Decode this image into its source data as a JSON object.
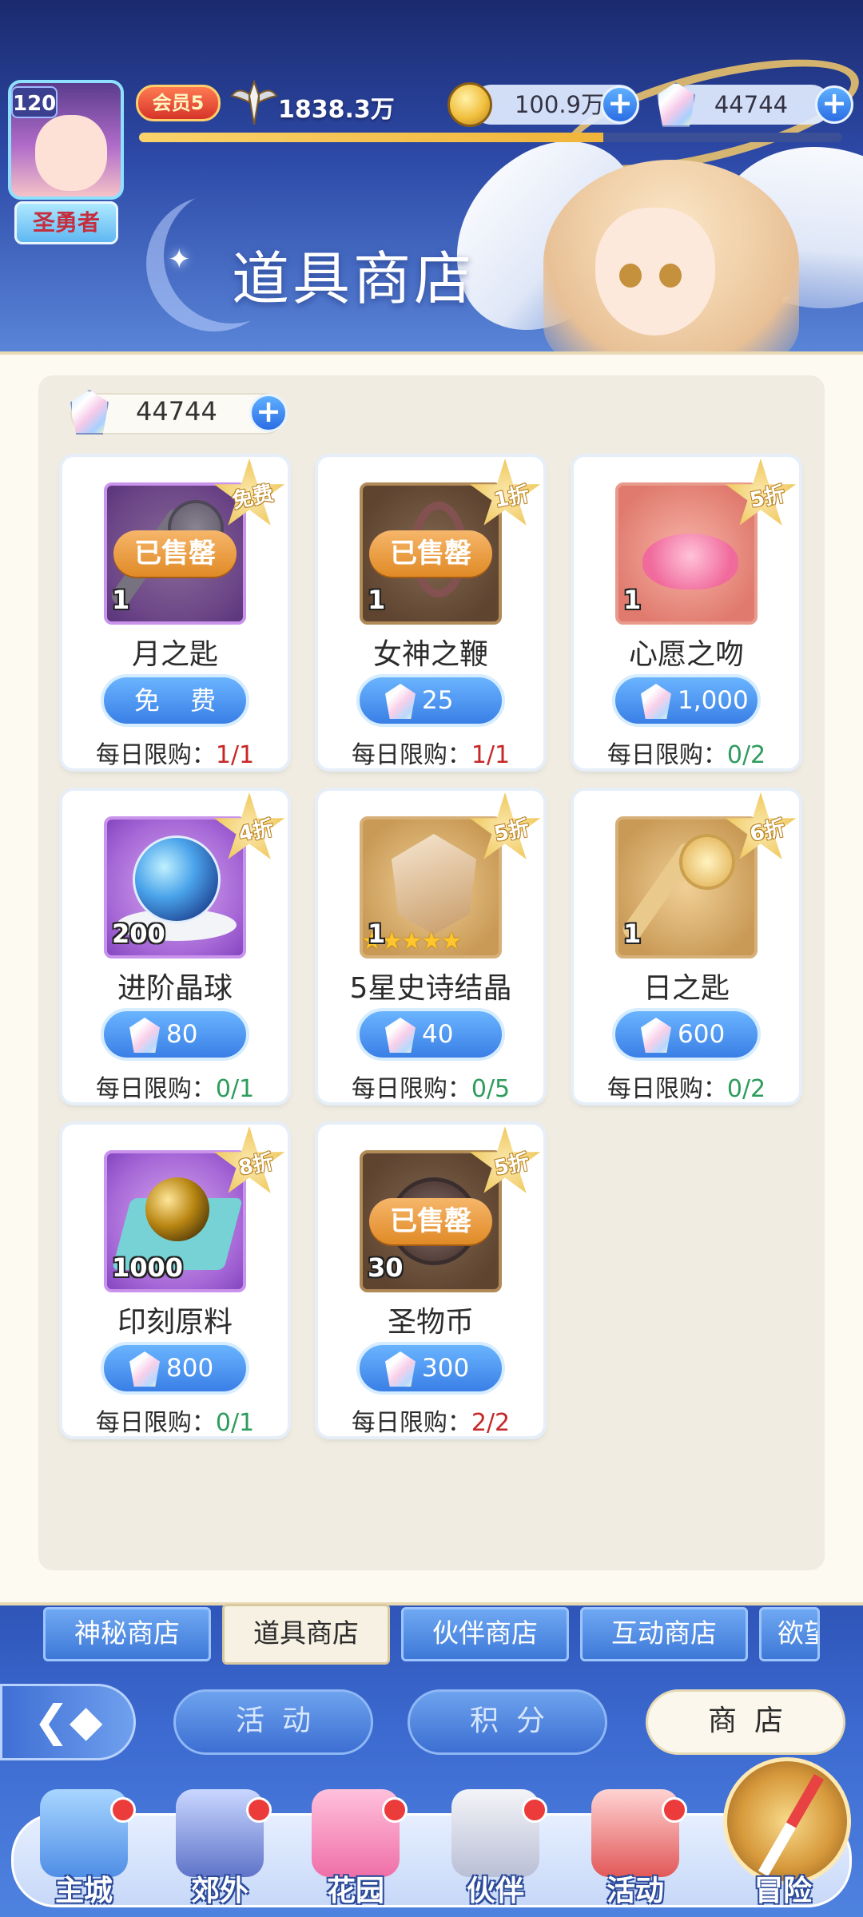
{
  "header": {
    "page_title": "道具商店",
    "player": {
      "level": "120",
      "title": "圣勇者",
      "vip": "会员5",
      "power": "1838.3万",
      "exp_fraction": 0.66
    },
    "currencies": {
      "coins": "100.9万",
      "gems": "44744"
    }
  },
  "shop": {
    "gem_balance": "44744",
    "limit_label": "每日限购：",
    "sold_out_label": "已售罄",
    "items": [
      {
        "name": "月之匙",
        "qty": "1",
        "discount": "免费",
        "price": "免 费",
        "free": true,
        "sold": true,
        "bought": "1",
        "max": "1",
        "art": "moon-key"
      },
      {
        "name": "女神之鞭",
        "qty": "1",
        "discount": "1折",
        "price": "25",
        "free": false,
        "sold": true,
        "bought": "1",
        "max": "1",
        "art": "whip"
      },
      {
        "name": "心愿之吻",
        "qty": "1",
        "discount": "5折",
        "price": "1,000",
        "free": false,
        "sold": false,
        "bought": "0",
        "max": "2",
        "art": "lips"
      },
      {
        "name": "进阶晶球",
        "qty": "200",
        "discount": "4折",
        "price": "80",
        "free": false,
        "sold": false,
        "bought": "0",
        "max": "1",
        "art": "orb"
      },
      {
        "name": "5星史诗结晶",
        "qty": "1",
        "discount": "5折",
        "price": "40",
        "free": false,
        "sold": false,
        "bought": "0",
        "max": "5",
        "art": "crystal",
        "stars": "★★★★★"
      },
      {
        "name": "日之匙",
        "qty": "1",
        "discount": "6折",
        "price": "600",
        "free": false,
        "sold": false,
        "bought": "0",
        "max": "2",
        "art": "sun-key"
      },
      {
        "name": "印刻原料",
        "qty": "1000",
        "discount": "8折",
        "price": "800",
        "free": false,
        "sold": false,
        "bought": "0",
        "max": "1",
        "art": "ore"
      },
      {
        "name": "圣物币",
        "qty": "30",
        "discount": "5折",
        "price": "300",
        "free": false,
        "sold": true,
        "bought": "2",
        "max": "2",
        "art": "relic-coin"
      }
    ]
  },
  "tabs": [
    "神秘商店",
    "道具商店",
    "伙伴商店",
    "互动商店",
    "欲望"
  ],
  "active_tab": "道具商店",
  "sub_buttons": [
    "活动",
    "积分",
    "商店"
  ],
  "nav": [
    "主城",
    "郊外",
    "花园",
    "伙伴",
    "活动",
    "冒险"
  ],
  "colors": {
    "accent_blue": "#3a7fe6",
    "limit_ok": "#2e9c5d",
    "limit_full": "#c62828",
    "sold_orange": "#e08a26"
  }
}
